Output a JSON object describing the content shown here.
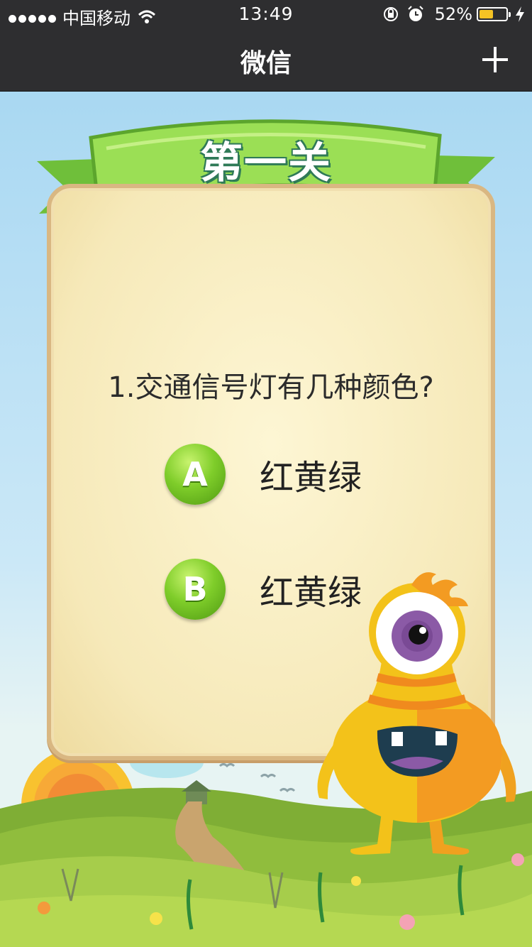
{
  "status_bar": {
    "carrier": "中国移动",
    "time": "13:49",
    "battery_percent": "52%",
    "battery_level": 0.52
  },
  "nav": {
    "title": "微信",
    "add_icon": "plus-icon"
  },
  "game": {
    "level_title": "第一关",
    "question": "1.交通信号灯有几种颜色?",
    "options": [
      {
        "letter": "A",
        "label": "红黄绿"
      },
      {
        "letter": "B",
        "label": "红黄绿"
      }
    ]
  },
  "colors": {
    "nav_bg": "#2e2e30",
    "option_ball": "#7fcd2a",
    "banner_green": "#8ed94a",
    "monster_yellow": "#f3c21a"
  }
}
